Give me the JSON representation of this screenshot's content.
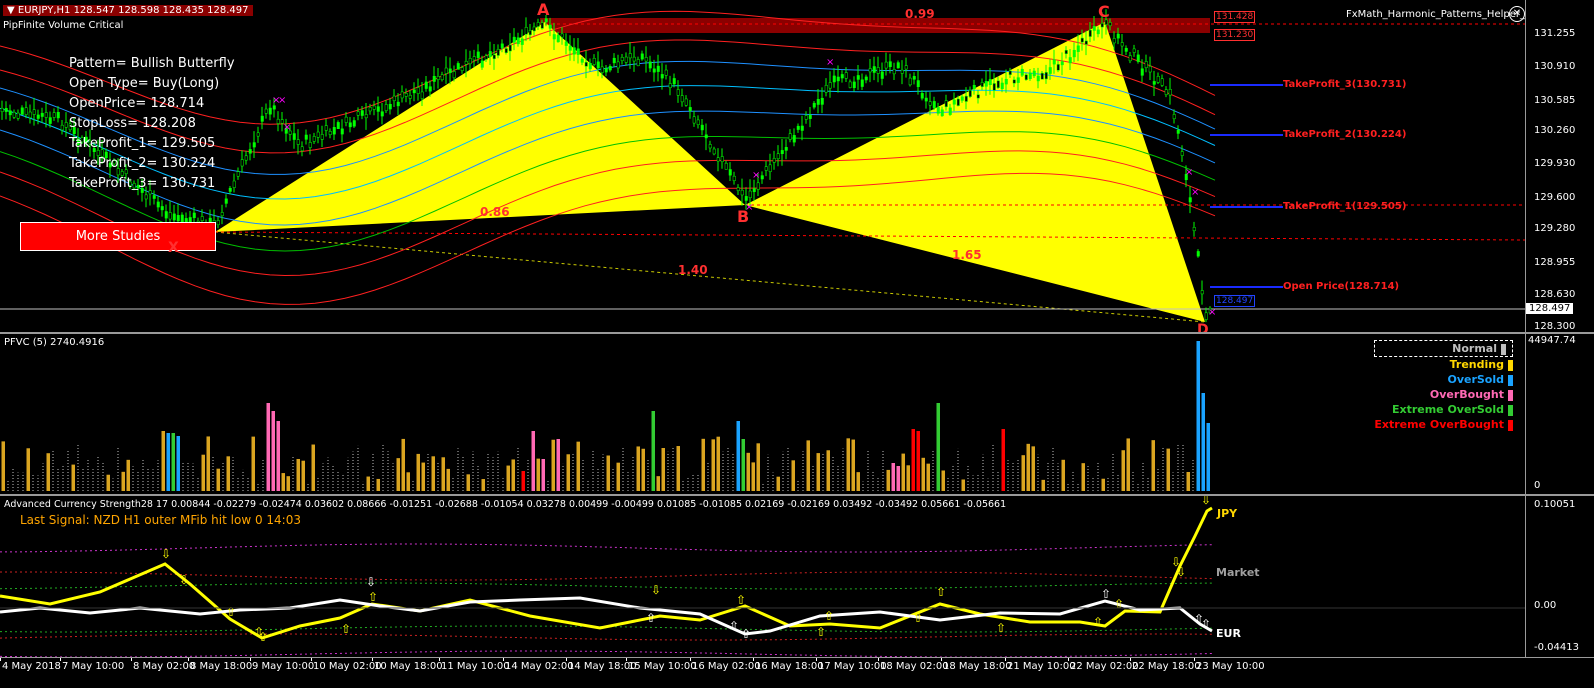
{
  "main": {
    "header": "▼ EURJPY,H1  128.547 128.598 128.435 128.497",
    "indicator_name": "PipFinite Volume Critical",
    "ea_name": "FxMath_Harmonic_Patterns_Helper_EA",
    "pattern_lines": [
      "Pattern= Bullish Butterfly",
      "Open Type= Buy(Long)",
      "OpenPrice= 128.714",
      "StopLoss= 128.208",
      "TakeProfit_1= 129.505",
      "TakeProfit_2= 130.224",
      "TakeProfit_3= 130.731"
    ],
    "more_studies": "More Studies",
    "points": {
      "A": "A",
      "B": "B",
      "C": "C",
      "D": "D",
      "X": "X"
    },
    "ratios": {
      "r1": "0.99",
      "r2": "0.86",
      "r3": "1.40",
      "r4": "1.65"
    },
    "tp_labels": {
      "tp3": "TakeProfit_3(130.731)",
      "tp2": "TakeProfit_2(130.224)",
      "tp1": "TakeProfit_1(129.505)",
      "open": "Open Price(128.714)"
    },
    "price_ticks": [
      "131.255",
      "130.910",
      "130.585",
      "130.260",
      "129.930",
      "129.600",
      "129.280",
      "128.955",
      "128.630",
      "128.300"
    ],
    "current_price": "128.497",
    "box_labels": {
      "top1": "131.428",
      "top2": "131.230",
      "bottom": "128.497"
    }
  },
  "volume": {
    "header": "PFVC (5) 2740.4916",
    "max_label": "44947.74",
    "zero_label": "0",
    "legend": [
      {
        "label": "Normal",
        "color": "#bfbfbf"
      },
      {
        "label": "Trending",
        "color": "#ffd700"
      },
      {
        "label": "OverSold",
        "color": "#1aa3ff"
      },
      {
        "label": "OverBought",
        "color": "#ff69b4"
      },
      {
        "label": "Extreme OverSold",
        "color": "#33cc33"
      },
      {
        "label": "Extreme OverBought",
        "color": "#ff0000"
      }
    ]
  },
  "strength": {
    "header": "Advanced Currency Strength28 17 0.00844 -0.02279 -0.02474 0.03602 0.08666 -0.01251 -0.02688 -0.01054 0.03278 0.00499 -0.00499 0.01085 -0.01085 0.02169 -0.02169 0.03492 -0.03492 0.05661 -0.05661",
    "signal": "Last Signal:  NZD H1 outer MFib hit low 0 14:03",
    "ticks": [
      "0.10051",
      "0.00",
      "-0.04413"
    ],
    "labels": {
      "jpy": "JPY",
      "market": "Market",
      "eur": "EUR"
    }
  },
  "time_axis": [
    "4 May 2018",
    "7 May 10:00",
    "8 May 02:00",
    "8 May 18:00",
    "9 May 10:00",
    "10 May 02:00",
    "10 May 18:00",
    "11 May 10:00",
    "14 May 02:00",
    "14 May 18:00",
    "15 May 10:00",
    "16 May 02:00",
    "16 May 18:00",
    "17 May 10:00",
    "18 May 02:00",
    "18 May 18:00",
    "21 May 10:00",
    "22 May 02:00",
    "22 May 18:00",
    "23 May 10:00"
  ],
  "colors": {
    "pattern_fill": "#ffff00",
    "tp_line": "#0000ff",
    "tp_label": "#ff0000",
    "candle": "#00ff00",
    "background": "#000000"
  }
}
